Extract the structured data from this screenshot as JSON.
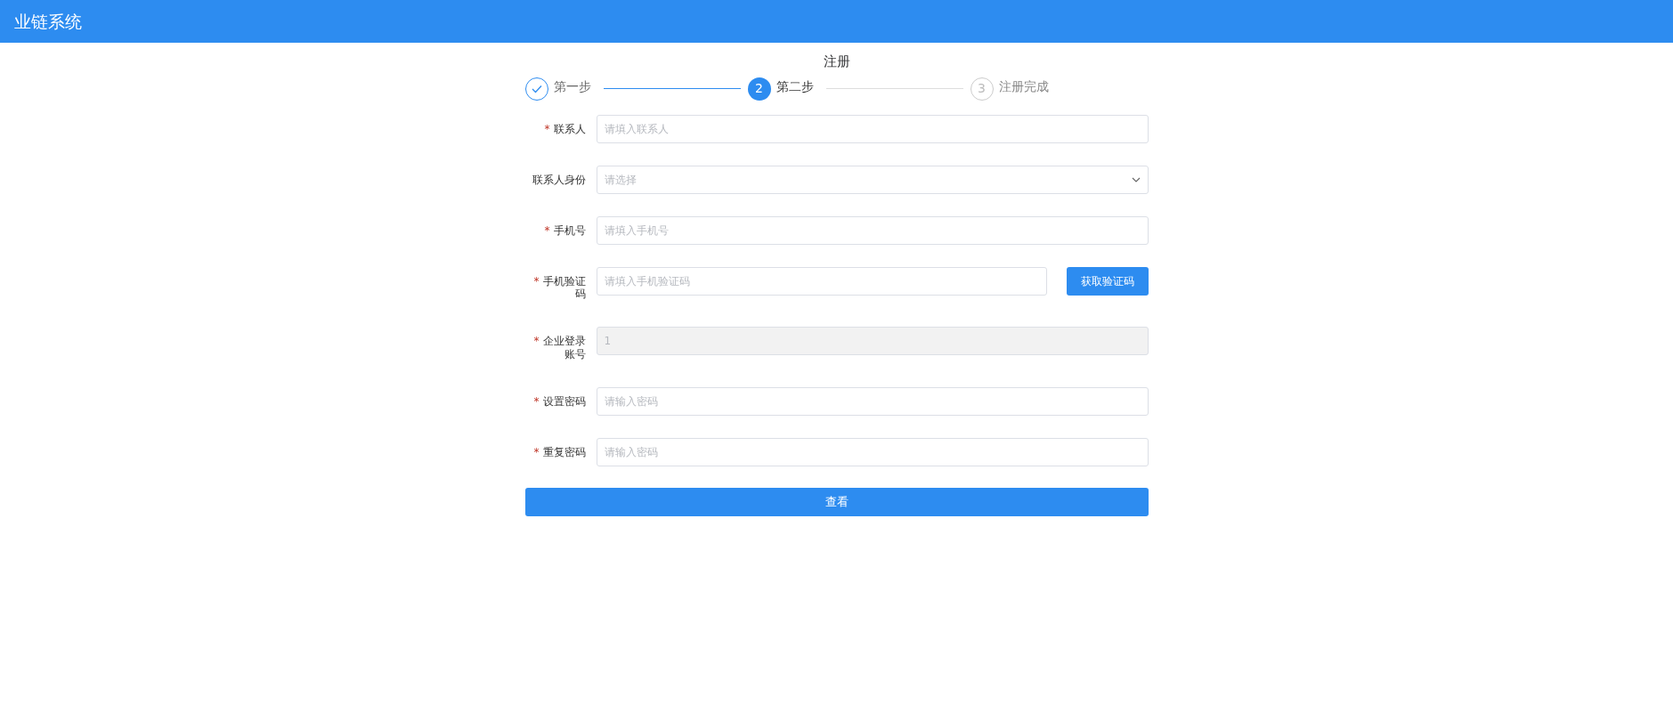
{
  "header": {
    "title": "业链系统"
  },
  "page_title": "注册",
  "steps": [
    {
      "label": "第一步",
      "completed": true,
      "selected": false
    },
    {
      "label": "第二步",
      "completed": false,
      "selected": true,
      "number": "2"
    },
    {
      "label": "注册完成",
      "completed": false,
      "selected": false,
      "number": "3"
    }
  ],
  "fields": [
    {
      "kind": "text",
      "marker": "*",
      "label": "联系人",
      "placeholder": "请填入联系人"
    },
    {
      "kind": "select",
      "label": "联系人身份",
      "placeholder": "请选择"
    },
    {
      "kind": "text",
      "marker": "*",
      "label": "手机号",
      "placeholder": "请填入手机号"
    },
    {
      "kind": "code",
      "marker": "*",
      "label": "手机验证码",
      "placeholder": "请填入手机验证码",
      "button": "获取验证码"
    },
    {
      "kind": "text",
      "marker": "*",
      "label": "企业登录账号",
      "value": "1",
      "disabled": true
    },
    {
      "kind": "text",
      "marker": "*",
      "label": "设置密码",
      "placeholder": "请输入密码"
    },
    {
      "kind": "text",
      "marker": "*",
      "label": "重复密码",
      "placeholder": "请输入密码"
    }
  ],
  "submit": "查看"
}
